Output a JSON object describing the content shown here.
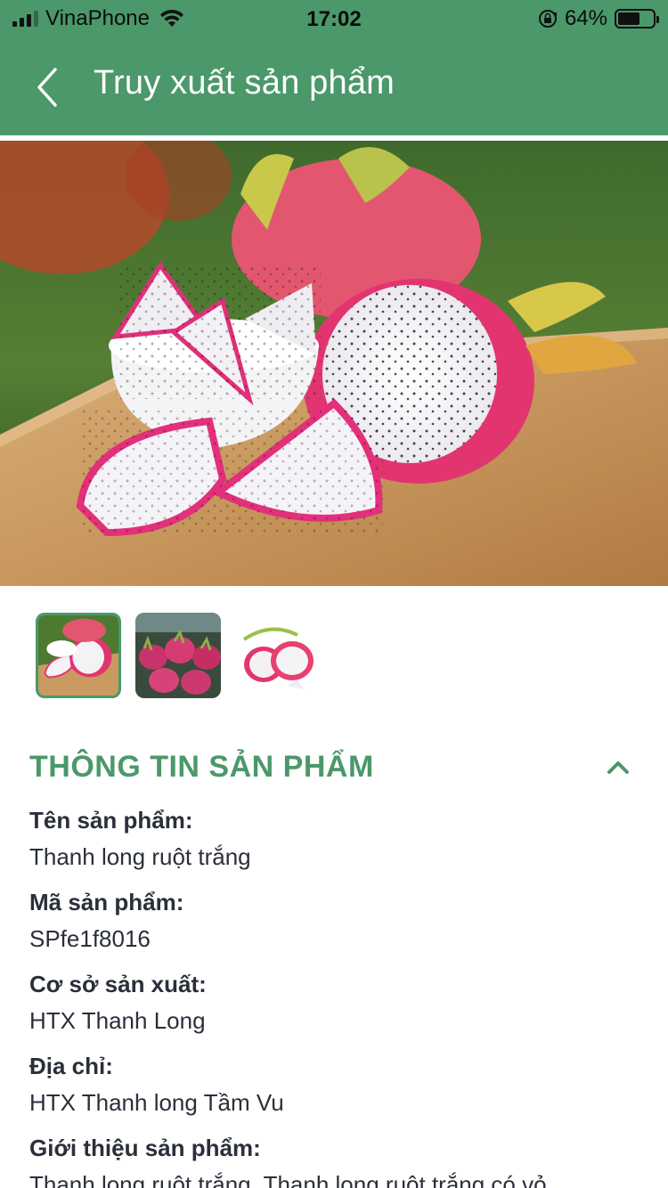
{
  "status_bar": {
    "carrier": "VinaPhone",
    "time": "17:02",
    "battery_percent": "64%",
    "battery_level": 0.64,
    "icons": [
      "signal-icon",
      "wifi-icon",
      "rotation-lock-icon",
      "battery-icon"
    ]
  },
  "nav": {
    "title": "Truy xuất sản phẩm",
    "back_icon": "chevron-left-icon"
  },
  "colors": {
    "brand_green": "#4b986a",
    "text_dark": "#2a2f3a"
  },
  "gallery": {
    "selected_index": 0,
    "thumbnails": [
      {
        "name": "thumbnail-sliced-dragon-fruit"
      },
      {
        "name": "thumbnail-dragon-fruit-pile"
      },
      {
        "name": "thumbnail-dragon-fruit-halves"
      }
    ]
  },
  "section": {
    "title": "THÔNG TIN SẢN PHẨM",
    "toggle_icon": "chevron-up-icon"
  },
  "product": {
    "name_label": "Tên sản phẩm:",
    "name_value": "Thanh long ruột trắng",
    "code_label": "Mã sản phẩm:",
    "code_value": "SPfe1f8016",
    "facility_label": "Cơ sở sản xuất:",
    "facility_value": "HTX Thanh Long",
    "address_label": "Địa chỉ:",
    "address_value": "HTX Thanh long Tầm Vu",
    "intro_label": "Giới thiệu sản phẩm:",
    "intro_value": "Thanh long ruột trắng. Thanh long ruột trắng có vỏ"
  }
}
